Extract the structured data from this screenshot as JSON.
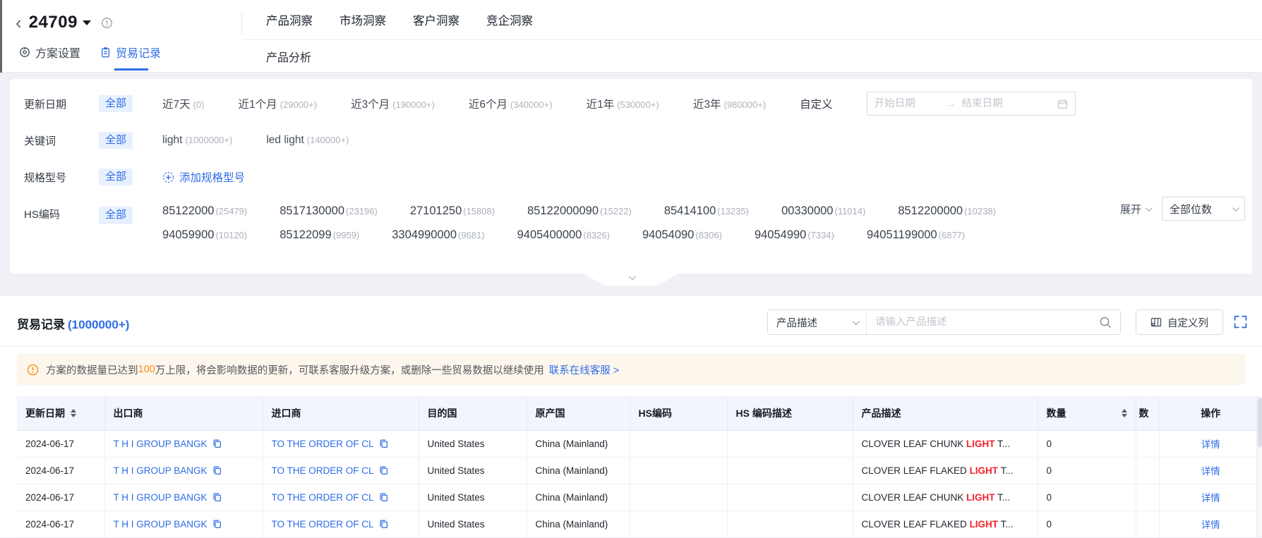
{
  "colors": {
    "accent": "#2e6ce6",
    "warning": "#fa8c16",
    "highlight": "#f5222d"
  },
  "header": {
    "back_icon": "‹",
    "plan_id": "24709",
    "tabs": [
      {
        "label": "方案设置"
      },
      {
        "label": "贸易记录"
      }
    ],
    "nav": [
      {
        "label": "产品洞察"
      },
      {
        "label": "市场洞察"
      },
      {
        "label": "客户洞察"
      },
      {
        "label": "竞企洞察"
      }
    ],
    "subnav": {
      "label": "产品分析"
    }
  },
  "filters": {
    "date": {
      "label": "更新日期",
      "all": "全部",
      "options": [
        {
          "name": "近7天",
          "count": "(0)"
        },
        {
          "name": "近1个月",
          "count": "(29000+)"
        },
        {
          "name": "近3个月",
          "count": "(190000+)"
        },
        {
          "name": "近6个月",
          "count": "(340000+)"
        },
        {
          "name": "近1年",
          "count": "(530000+)"
        },
        {
          "name": "近3年",
          "count": "(980000+)"
        }
      ],
      "custom_label": "自定义",
      "start_placeholder": "开始日期",
      "end_placeholder": "结束日期",
      "range_separator": "→"
    },
    "keyword": {
      "label": "关键词",
      "all": "全部",
      "options": [
        {
          "name": "light",
          "count": "(1000000+)"
        },
        {
          "name": "led light",
          "count": "(140000+)"
        }
      ]
    },
    "spec": {
      "label": "规格型号",
      "all": "全部",
      "add_label": "添加规格型号"
    },
    "hs": {
      "label": "HS编码",
      "all": "全部",
      "row1": [
        {
          "name": "85122000",
          "count": "(25479)"
        },
        {
          "name": "8517130000",
          "count": "(23196)"
        },
        {
          "name": "27101250",
          "count": "(15808)"
        },
        {
          "name": "85122000090",
          "count": "(15222)"
        },
        {
          "name": "85414100",
          "count": "(13235)"
        },
        {
          "name": "00330000",
          "count": "(11014)"
        },
        {
          "name": "8512200000",
          "count": "(10238)"
        }
      ],
      "row2": [
        {
          "name": "94059900",
          "count": "(10120)"
        },
        {
          "name": "85122099",
          "count": "(9959)"
        },
        {
          "name": "3304990000",
          "count": "(9681)"
        },
        {
          "name": "9405400000",
          "count": "(8326)"
        },
        {
          "name": "94054090",
          "count": "(8306)"
        },
        {
          "name": "94054990",
          "count": "(7334)"
        },
        {
          "name": "94051199000",
          "count": "(6877)"
        }
      ],
      "expand_label": "展开",
      "digits_select": "全部位数"
    }
  },
  "records": {
    "title": "贸易记录",
    "count": "(1000000+)",
    "search": {
      "field": "产品描述",
      "placeholder": "请输入产品描述"
    },
    "customize_label": "自定义列",
    "notice": {
      "text_before": "方案的数据量已达到",
      "highlight": "100",
      "text_after": "万上限，将会影响数据的更新，可联系客服升级方案，或删除一些贸易数据以继续使用",
      "link": "联系在线客服 >"
    },
    "table": {
      "columns": [
        "更新日期",
        "出口商",
        "进口商",
        "目的国",
        "原产国",
        "HS编码",
        "HS 编码描述",
        "产品描述",
        "数量",
        "数",
        "操作"
      ],
      "rows": [
        {
          "date": "2024-06-17",
          "exporter": "T H I GROUP BANGK",
          "importer": "TO THE ORDER OF CL",
          "destination": "United States",
          "origin": "China (Mainland)",
          "hs_code": "",
          "hs_desc": "",
          "desc_before": "CLOVER LEAF CHUNK ",
          "desc_highlight": "LIGHT",
          "desc_after": " T...",
          "quantity": "0",
          "action": "详情"
        },
        {
          "date": "2024-06-17",
          "exporter": "T H I GROUP BANGK",
          "importer": "TO THE ORDER OF CL",
          "destination": "United States",
          "origin": "China (Mainland)",
          "hs_code": "",
          "hs_desc": "",
          "desc_before": "CLOVER LEAF FLAKED ",
          "desc_highlight": "LIGHT",
          "desc_after": " T...",
          "quantity": "0",
          "action": "详情"
        },
        {
          "date": "2024-06-17",
          "exporter": "T H I GROUP BANGK",
          "importer": "TO THE ORDER OF CL",
          "destination": "United States",
          "origin": "China (Mainland)",
          "hs_code": "",
          "hs_desc": "",
          "desc_before": "CLOVER LEAF CHUNK ",
          "desc_highlight": "LIGHT",
          "desc_after": " T...",
          "quantity": "0",
          "action": "详情"
        },
        {
          "date": "2024-06-17",
          "exporter": "T H I GROUP BANGK",
          "importer": "TO THE ORDER OF CL",
          "destination": "United States",
          "origin": "China (Mainland)",
          "hs_code": "",
          "hs_desc": "",
          "desc_before": "CLOVER LEAF FLAKED ",
          "desc_highlight": "LIGHT",
          "desc_after": " T...",
          "quantity": "0",
          "action": "详情"
        }
      ]
    }
  }
}
